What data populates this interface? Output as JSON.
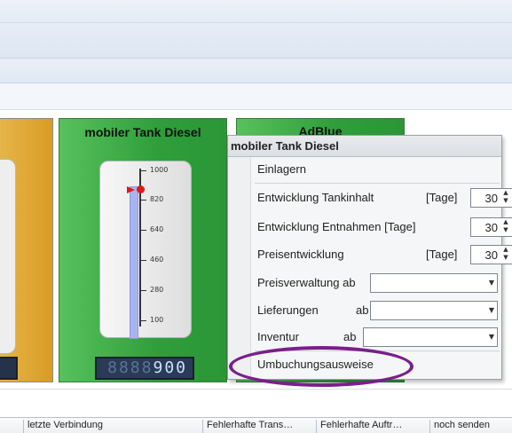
{
  "tiles": {
    "tank1_title": "mobiler Tank Diesel",
    "tank1_scale": [
      "1000",
      "820",
      "640",
      "460",
      "280",
      "100"
    ],
    "tank1_display_dim": "8888",
    "tank1_display_value": "900",
    "tank2_title": "AdBlue"
  },
  "context_menu": {
    "title": "mobiler Tank Diesel",
    "einlagern": "Einlagern",
    "tankinhalt_label": "Entwicklung Tankinhalt",
    "tankinhalt_unit": "[Tage]",
    "tankinhalt_value": "30",
    "entnahmen_label": "Entwicklung Entnahmen [Tage]",
    "entnahmen_value": "30",
    "preisentwicklung_label": "Preisentwicklung",
    "preisentwicklung_unit": "[Tage]",
    "preisentwicklung_value": "30",
    "preisverwaltung_label": "Preisverwaltung ab",
    "lieferungen_label": "Lieferungen",
    "lieferungen_ab": "ab",
    "inventur_label": "Inventur",
    "inventur_ab": "ab",
    "umbuchung_label": "Umbuchungsausweise"
  },
  "grid_headers": [
    "letzte Verbindung",
    "Fehlerhafte Trans…",
    "Fehlerhafte Auftr…",
    "noch senden"
  ],
  "colors": {
    "highlight": "#7a1f8a",
    "tank_green": "#2e9e3a",
    "tank_orange": "#d99c24"
  }
}
